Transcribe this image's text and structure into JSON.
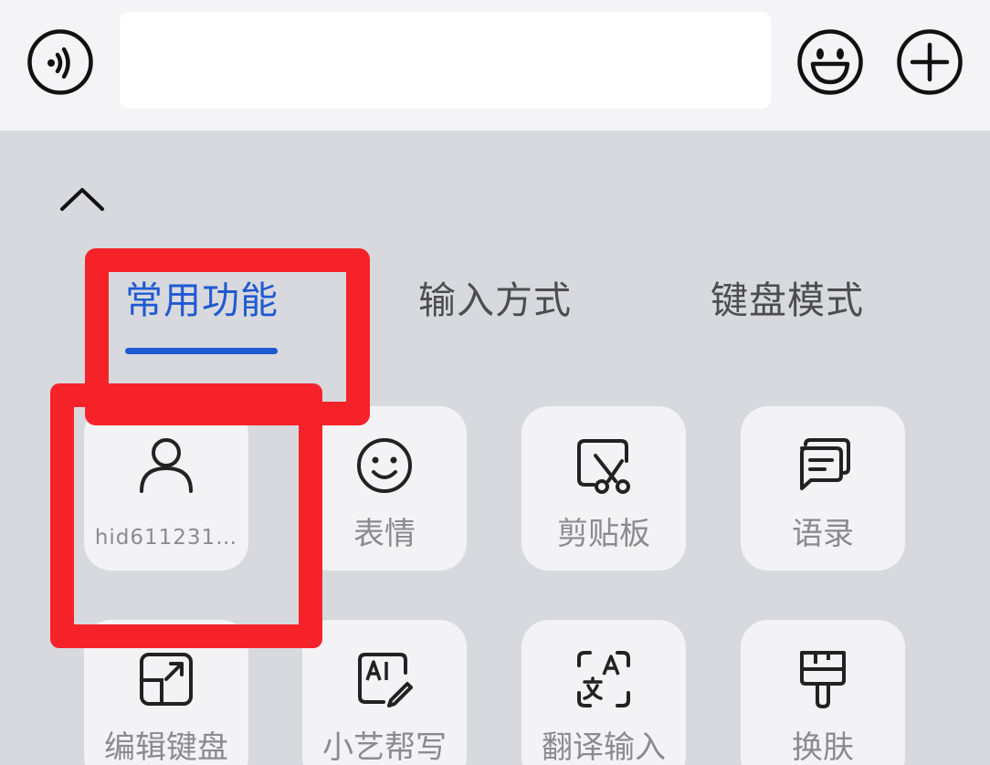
{
  "input_bar": {
    "voice_icon": "voice-input-icon",
    "text_value": "",
    "emoji_icon": "emoji-icon",
    "add_icon": "plus-icon"
  },
  "panel": {
    "collapse_icon": "chevron-up-icon",
    "tabs": [
      {
        "label": "常用功能",
        "active": true
      },
      {
        "label": "输入方式",
        "active": false
      },
      {
        "label": "键盘模式",
        "active": false
      }
    ],
    "accent_color": "#1f5ad1",
    "tiles": [
      {
        "label": "hid611231…",
        "icon": "person-icon"
      },
      {
        "label": "表情",
        "icon": "smiley-icon"
      },
      {
        "label": "剪贴板",
        "icon": "clipboard-scissors-icon"
      },
      {
        "label": "语录",
        "icon": "chat-bubbles-icon"
      },
      {
        "label": "编辑键盘",
        "icon": "edit-keyboard-icon"
      },
      {
        "label": "小艺帮写",
        "icon": "ai-write-icon"
      },
      {
        "label": "翻译输入",
        "icon": "translate-icon"
      },
      {
        "label": "换肤",
        "icon": "paint-brush-icon"
      }
    ]
  },
  "highlight_color": "#f52329"
}
